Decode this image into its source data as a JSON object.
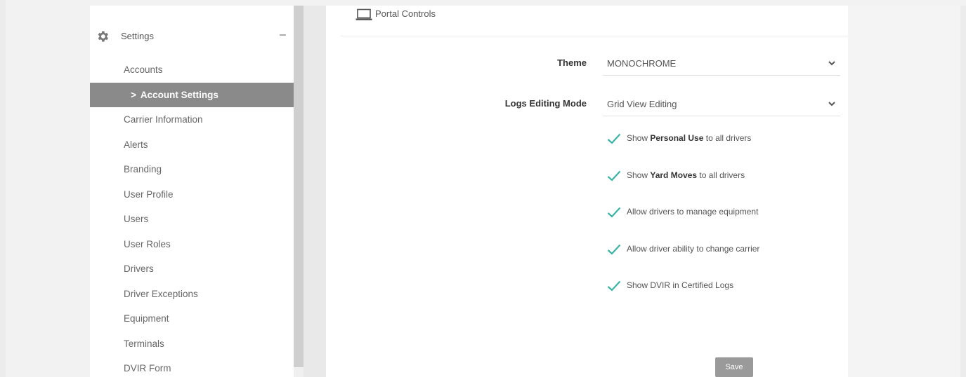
{
  "sidebar": {
    "section_label": "Settings",
    "collapse_symbol": "–",
    "section_icon": "gear-icon",
    "items": [
      {
        "label": "Accounts"
      },
      {
        "label": "Account Settings",
        "active": true
      },
      {
        "label": "Carrier Information"
      },
      {
        "label": "Alerts"
      },
      {
        "label": "Branding"
      },
      {
        "label": "User Profile"
      },
      {
        "label": "Users"
      },
      {
        "label": "User Roles"
      },
      {
        "label": "Drivers"
      },
      {
        "label": "Driver Exceptions"
      },
      {
        "label": "Equipment"
      },
      {
        "label": "Terminals"
      },
      {
        "label": "DVIR Form"
      }
    ],
    "active_chevron": ">"
  },
  "panel": {
    "title": "Portal Controls",
    "title_icon": "laptop-icon",
    "theme": {
      "label": "Theme",
      "value": "MONOCHROME"
    },
    "logs_mode": {
      "label": "Logs Editing Mode",
      "value": "Grid View Editing"
    },
    "checkboxes": [
      {
        "pre": "Show ",
        "bold": "Personal Use",
        "post": " to all drivers",
        "checked": true
      },
      {
        "pre": "Show ",
        "bold": "Yard Moves",
        "post": " to all drivers",
        "checked": true
      },
      {
        "pre": "Allow drivers to manage equipment",
        "bold": "",
        "post": "",
        "checked": true
      },
      {
        "pre": "Allow driver ability to change carrier",
        "bold": "",
        "post": "",
        "checked": true
      },
      {
        "pre": "Show DVIR in Certified Logs",
        "bold": "",
        "post": "",
        "checked": true
      }
    ],
    "save_label": "Save"
  },
  "colors": {
    "check_accent": "#3bb3a3",
    "active_nav_bg": "#8a8a8a",
    "save_bg": "#9a9a9a"
  }
}
